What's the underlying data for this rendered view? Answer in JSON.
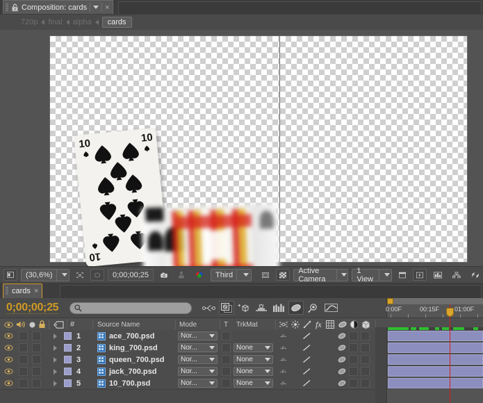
{
  "comp_panel": {
    "tab_label": "Composition: cards",
    "close_label": "×",
    "breadcrumb": [
      {
        "label": "720p",
        "active": false
      },
      {
        "label": "final",
        "active": false
      },
      {
        "label": "alpha",
        "active": false
      },
      {
        "label": "cards",
        "active": true
      }
    ]
  },
  "viewer_toolbar": {
    "zoom_level": "(30,6%)",
    "timecode": "0;00;00;25",
    "resolution": "Third",
    "camera": "Active Camera",
    "views": "1 View",
    "icons": [
      "toggle-alpha-icon",
      "region-of-interest-icon",
      "mask-visibility-icon",
      "take-snapshot-icon",
      "show-snapshot-icon",
      "channel-rgb-icon",
      "toggle-transparency-grid-icon",
      "toggle-guides-icon",
      "timeline-preview-icon",
      "histogram-icon",
      "comp-flowchart-icon",
      "fast-previews-icon"
    ]
  },
  "timeline": {
    "tab_label": "cards",
    "close_label": "×",
    "current_time": "0;00;00;25",
    "search_placeholder": "",
    "toolbar_icons": [
      "composition-mini-flowchart-icon",
      "draft-3d-icon",
      "hide-shy-layers-icon",
      "frame-blending-icon",
      "motion-blur-icon",
      "graph-editor-icon",
      "brainstorm-icon",
      "auto-keyframe-icon"
    ],
    "ruler": {
      "labels": [
        "0:00F",
        "00:15F",
        "01:00F"
      ],
      "label_positions": [
        2,
        52,
        102
      ]
    },
    "columns": [
      {
        "name": "eye",
        "label": ""
      },
      {
        "name": "audio",
        "label": ""
      },
      {
        "name": "solo",
        "label": ""
      },
      {
        "name": "lock",
        "label": ""
      },
      {
        "name": "label",
        "label": ""
      },
      {
        "name": "number",
        "label": "#"
      },
      {
        "name": "source_name",
        "label": "Source Name"
      },
      {
        "name": "mode",
        "label": "Mode"
      },
      {
        "name": "t",
        "label": "T"
      },
      {
        "name": "trkmat",
        "label": "TrkMat"
      }
    ],
    "switch_icons": [
      "shy-icon",
      "collapse-transformations-icon",
      "quality-icon",
      "effects-icon",
      "frame-blend-icon",
      "motion-blur-icon",
      "adjustment-layer-icon",
      "3d-layer-icon"
    ],
    "layers": [
      {
        "num": "1",
        "source_name": "ace_700.psd",
        "mode": "Nor...",
        "trkmat": "",
        "has_trkmat": false
      },
      {
        "num": "2",
        "source_name": "king_700.psd",
        "mode": "Nor...",
        "trkmat": "None",
        "has_trkmat": true
      },
      {
        "num": "3",
        "source_name": "queen_700.psd",
        "mode": "Nor...",
        "trkmat": "None",
        "has_trkmat": true
      },
      {
        "num": "4",
        "source_name": "jack_700.psd",
        "mode": "Nor...",
        "trkmat": "None",
        "has_trkmat": true
      },
      {
        "num": "5",
        "source_name": "10_700.psd",
        "mode": "Nor...",
        "trkmat": "None",
        "has_trkmat": true
      }
    ]
  },
  "colors": {
    "panel_bg": "#4a4a4a",
    "accent_orange": "#d39a2a",
    "timecode_gold": "#cf9a24",
    "layer_bar": "#8c8fbe",
    "playhead_red": "#d02020",
    "cache_green": "#2fbe2f",
    "psd_icon_blue": "#2f6fb5"
  },
  "canvas": {
    "card_front_rank": "10",
    "card_front_suit": "spades",
    "blurred_card": "face-card-motion-blurred"
  }
}
